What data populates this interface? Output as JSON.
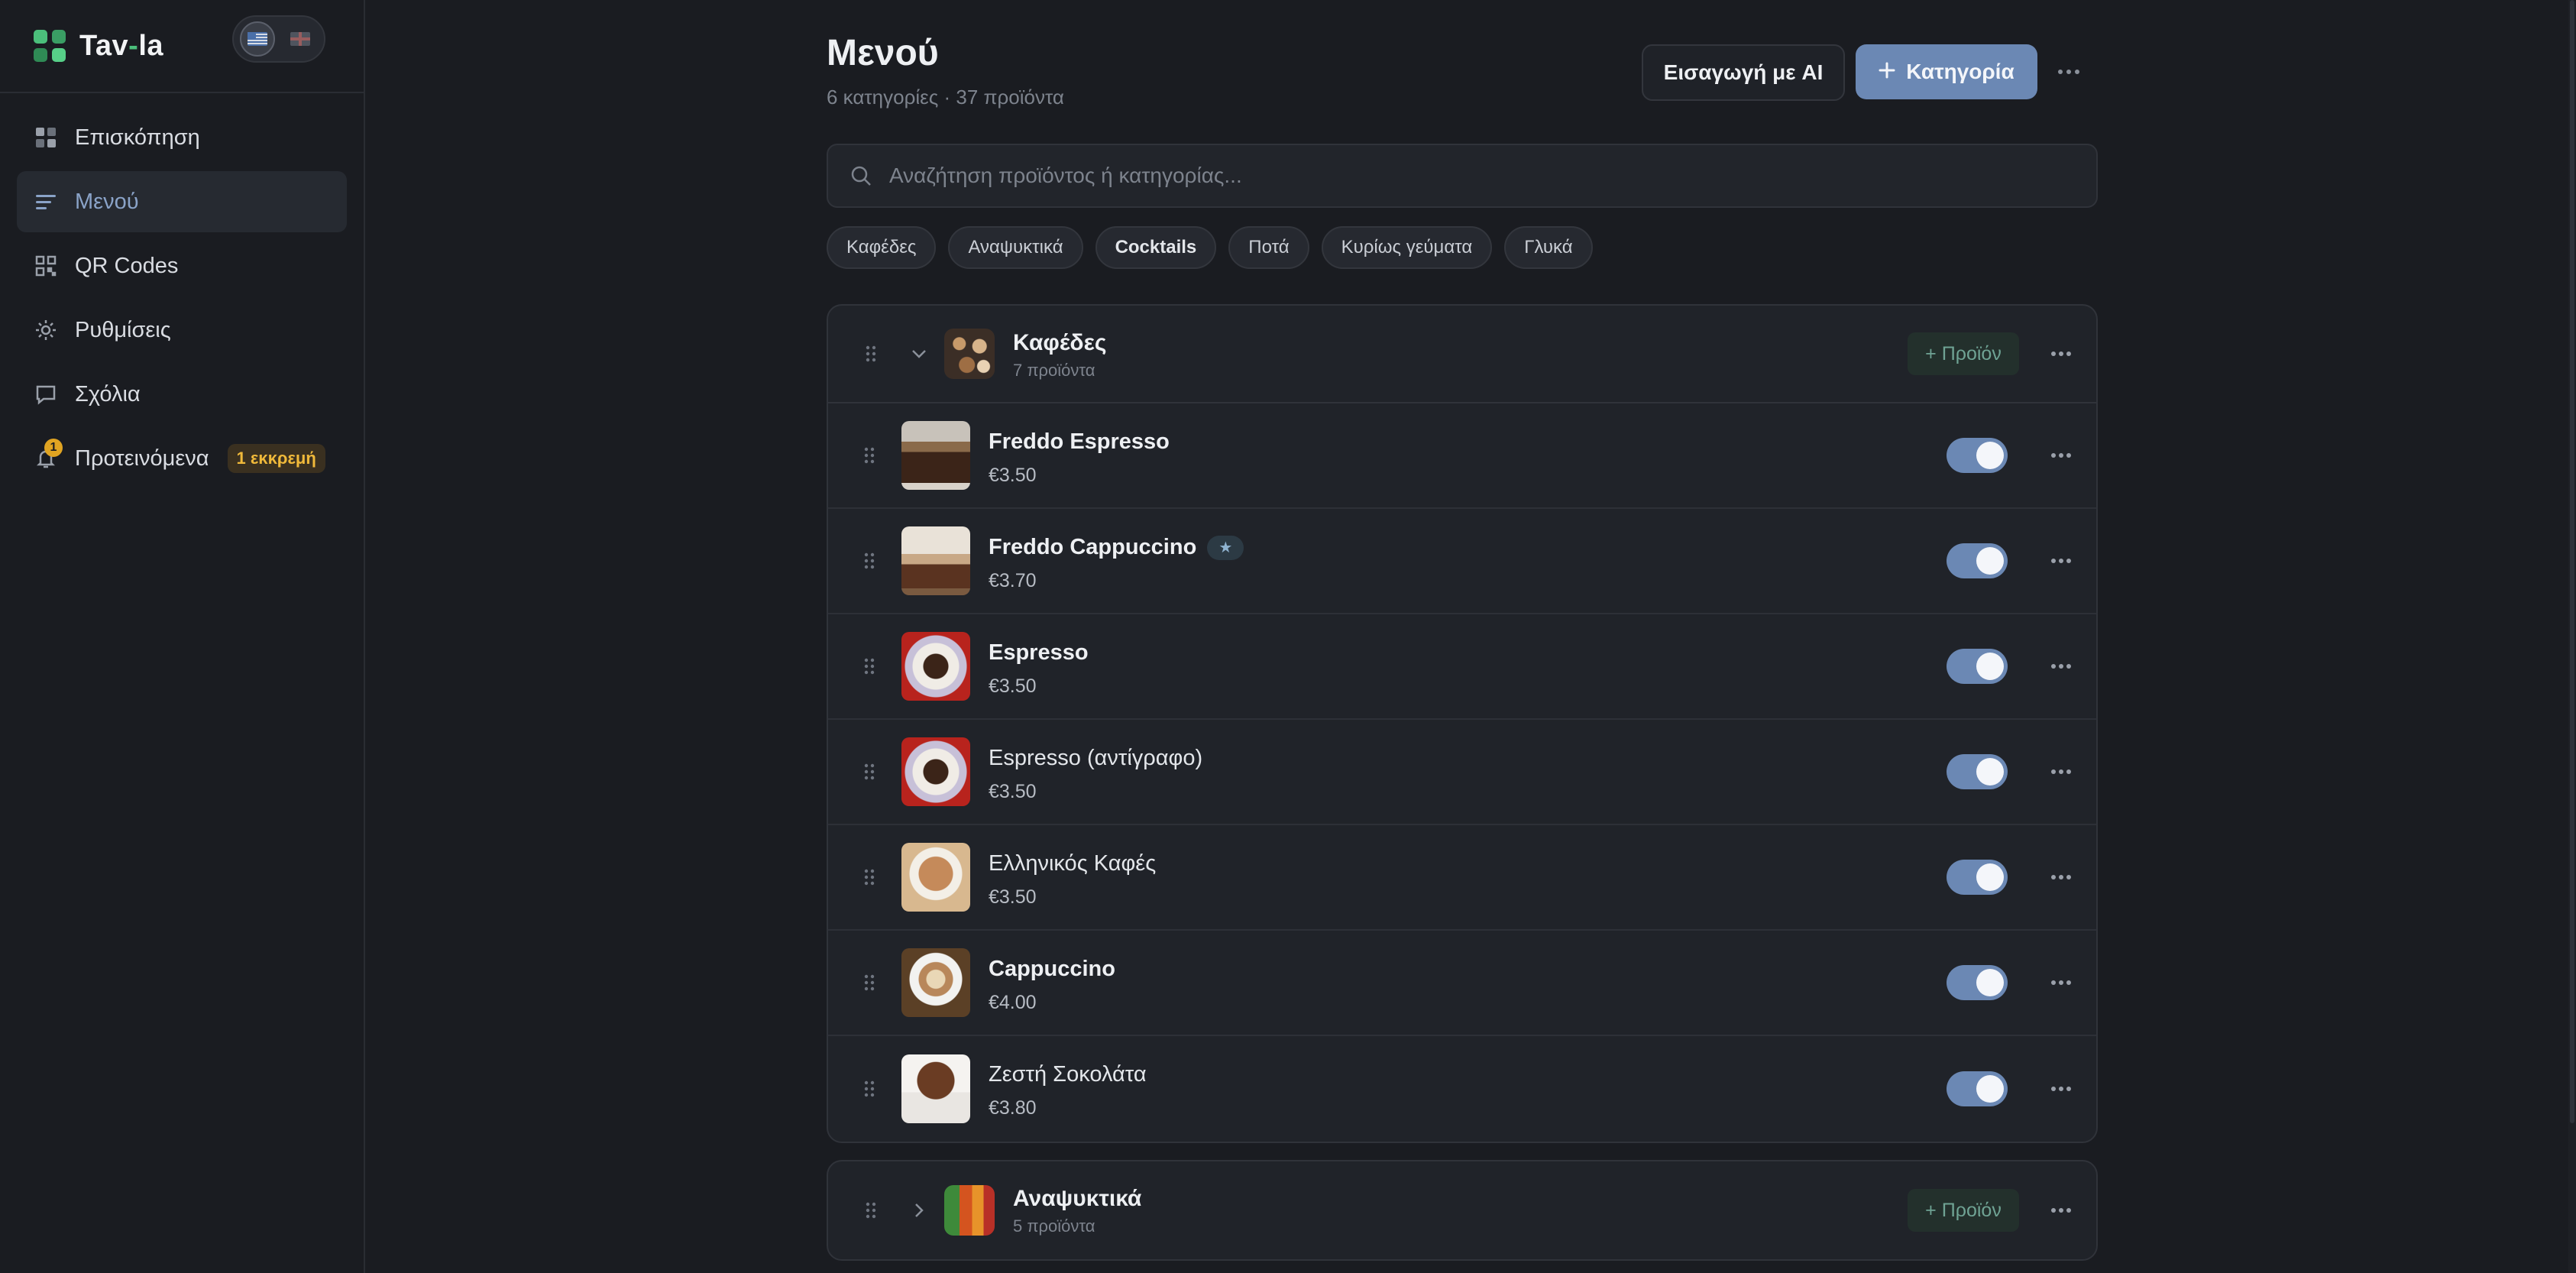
{
  "brand": {
    "name_part1": "Tav",
    "name_dash": "-",
    "name_part2": "la"
  },
  "languages": [
    {
      "code": "el",
      "icon": "greek-flag-icon",
      "active": true
    },
    {
      "code": "en",
      "icon": "uk-flag-icon",
      "active": false
    }
  ],
  "sidebar": {
    "items": [
      {
        "label": "Επισκόπηση",
        "icon": "dashboard-icon",
        "active": false
      },
      {
        "label": "Μενού",
        "icon": "menu-lines-icon",
        "active": true
      },
      {
        "label": "QR Codes",
        "icon": "qr-code-icon",
        "active": false
      },
      {
        "label": "Ρυθμίσεις",
        "icon": "settings-sun-icon",
        "active": false
      },
      {
        "label": "Σχόλια",
        "icon": "comment-icon",
        "active": false
      },
      {
        "label": "Προτεινόμενα",
        "icon": "bell-icon",
        "active": false,
        "notif_count": "1",
        "pending_label": "1 εκκρεμή"
      }
    ]
  },
  "header": {
    "title": "Μενού",
    "subtitle": "6 κατηγορίες · 37 προϊόντα",
    "ai_button": "Εισαγωγή με AI",
    "add_category_button": "Κατηγορία",
    "more_icon": "more-horizontal-icon"
  },
  "search": {
    "placeholder": "Αναζήτηση προϊόντος ή κατηγορίας...",
    "value": ""
  },
  "filters": [
    "Καφέδες",
    "Αναψυκτικά",
    "Cocktails",
    "Ποτά",
    "Κυρίως γεύματα",
    "Γλυκά"
  ],
  "categories": [
    {
      "name": "Καφέδες",
      "count": "7 προϊόντα",
      "expanded": true,
      "add_product_label": "+ Προϊόν",
      "items": [
        {
          "name": "Freddo Espresso",
          "price": "€3.50",
          "enabled": true,
          "featured": false
        },
        {
          "name": "Freddo Cappuccino",
          "price": "€3.70",
          "enabled": true,
          "featured": true
        },
        {
          "name": "Espresso",
          "price": "€3.50",
          "enabled": true,
          "featured": false
        },
        {
          "name": "Espresso (αντίγραφο)",
          "price": "€3.50",
          "enabled": true,
          "featured": false
        },
        {
          "name": "Ελληνικός Καφές",
          "price": "€3.50",
          "enabled": true,
          "featured": false
        },
        {
          "name": "Cappuccino",
          "price": "€4.00",
          "enabled": true,
          "featured": false
        },
        {
          "name": "Ζεστή Σοκολάτα",
          "price": "€3.80",
          "enabled": true,
          "featured": false
        }
      ]
    },
    {
      "name": "Αναψυκτικά",
      "count": "5 προϊόντα",
      "expanded": false,
      "add_product_label": "+ Προϊόν"
    }
  ],
  "colors": {
    "accent": "#6b88b4",
    "brand_green": "#4bbf7b",
    "pending": "#f0b93a",
    "background": "#1a1c21"
  }
}
